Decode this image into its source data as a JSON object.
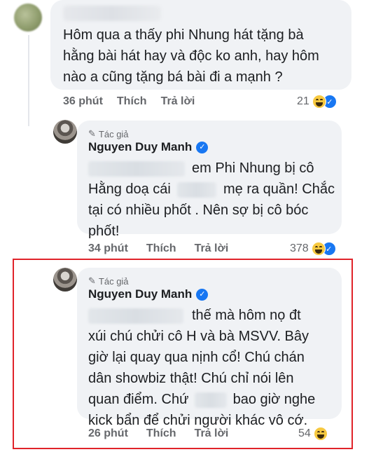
{
  "comment1": {
    "text": "Hôm qua a thấy phi Nhung hát tặng bà hằng bài hát hay và độc ko anh, hay hôm nào a cũng tặng bá bài đi a mạnh ?",
    "line1": "Hôm qua a thấy phi Nhung hát tặng bà",
    "line2": "hằng bài hát hay và độc ko anh, hay hôm",
    "line3": "nào a cũng tặng bá bài đi a mạnh ?",
    "time": "36 phút",
    "like_label": "Thích",
    "reply_label": "Trả lời",
    "reaction_count": "21"
  },
  "reply1": {
    "author_tag": "Tác giả",
    "author_name": "Nguyen Duy Manh",
    "line1": "em Phi Nhung bị cô",
    "line2_a": "Hằng doạ cái",
    "line2_b": "mẹ ra quần! Chắc",
    "line3": "tại có nhiều phốt . Nên sợ bị cô bóc",
    "line4": "phốt!",
    "time": "34 phút",
    "like_label": "Thích",
    "reply_label": "Trả lời",
    "reaction_count": "378"
  },
  "reply2": {
    "author_tag": "Tác giả",
    "author_name": "Nguyen Duy Manh",
    "line1": "thế mà hôm nọ đt",
    "line2": "xúi chú chửi cô H và bà MSVV. Bây",
    "line3": "giờ lại quay qua nịnh cổ! Chú chán",
    "line4": "dân showbiz thật! Chú chỉ nói lên",
    "line5_a": "quan điểm. Chứ",
    "line5_b": "bao giờ nghe",
    "line6": "kick bẩn để chửi người khác vô cớ.",
    "time": "26 phút",
    "like_label": "Thích",
    "reply_label": "Trả lời",
    "reaction_count": "54"
  },
  "icons": {
    "pencil": "✎",
    "verified": "✓",
    "like": "👍"
  },
  "colors": {
    "highlight": "#e0232a",
    "bubble": "#f0f2f5",
    "verified": "#1877f2"
  }
}
